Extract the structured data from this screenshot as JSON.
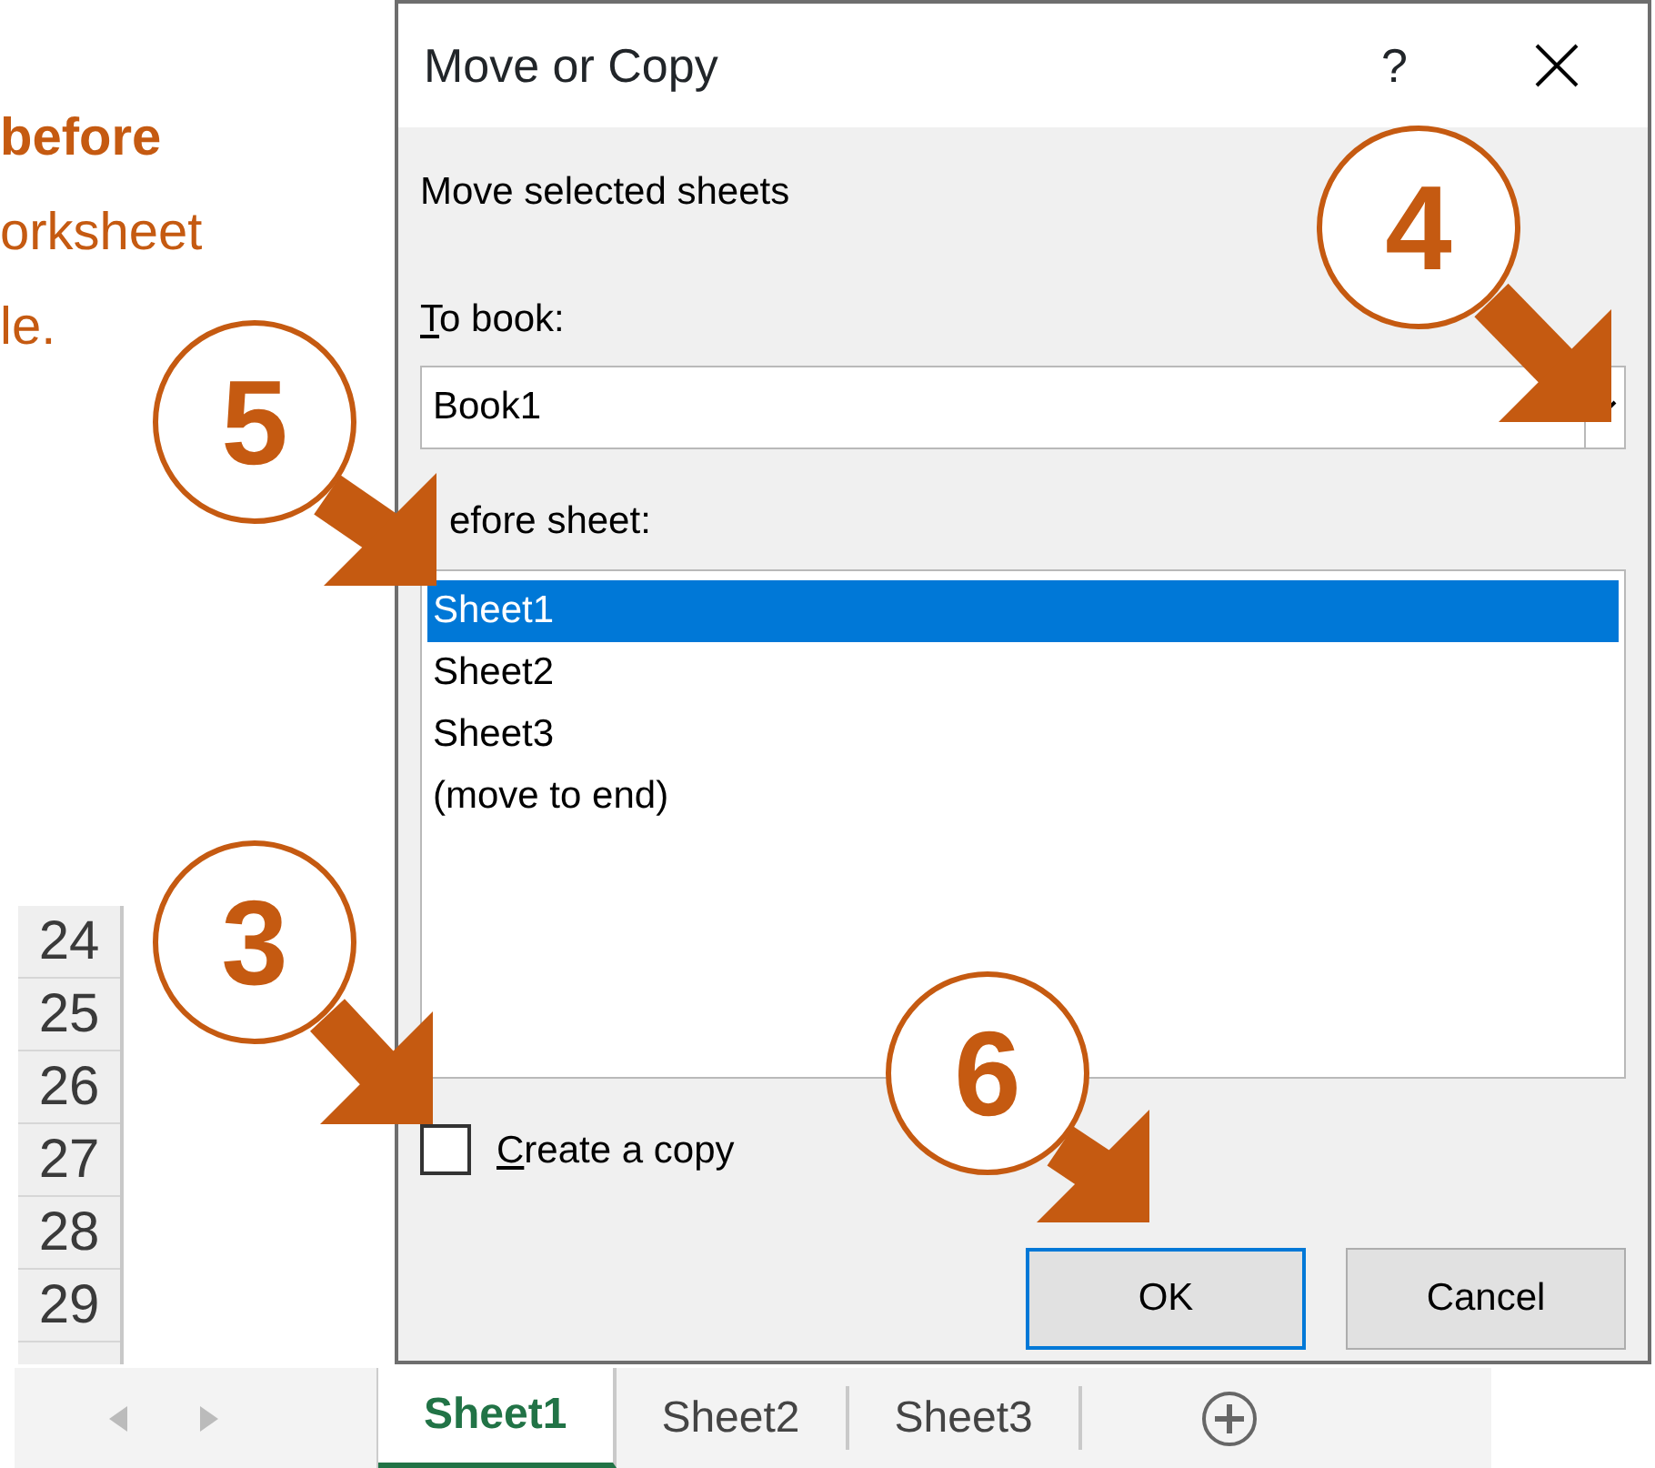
{
  "instruction_lines": [
    {
      "text": "before",
      "bold": true
    },
    {
      "text": "orksheet",
      "bold": false
    },
    {
      "text": "le.",
      "bold": false
    }
  ],
  "row_headers": [
    "24",
    "25",
    "26",
    "27",
    "28",
    "29"
  ],
  "dialog": {
    "title": "Move or Copy",
    "help": "?",
    "subtitle": "Move selected sheets",
    "to_book_label": {
      "text": "To book:",
      "underline_first": true
    },
    "to_book_value": "Book1",
    "before_sheet_label": {
      "text": "efore sheet:"
    },
    "sheets": [
      {
        "label": "Sheet1",
        "selected": true
      },
      {
        "label": "Sheet2",
        "selected": false
      },
      {
        "label": "Sheet3",
        "selected": false
      },
      {
        "label": "(move to end)",
        "selected": false
      }
    ],
    "copy_checkbox": {
      "label": "Create a copy",
      "checked": false,
      "underline_first": true
    },
    "buttons": [
      {
        "label": "OK",
        "focused": true
      },
      {
        "label": "Cancel",
        "focused": false
      }
    ]
  },
  "sheet_tabs": [
    {
      "label": "Sheet1",
      "selected": true
    },
    {
      "label": "Sheet2",
      "selected": false
    },
    {
      "label": "Sheet3",
      "selected": false
    }
  ],
  "callouts": [
    {
      "number": "5"
    },
    {
      "number": "4"
    },
    {
      "number": "3"
    },
    {
      "number": "6"
    }
  ]
}
